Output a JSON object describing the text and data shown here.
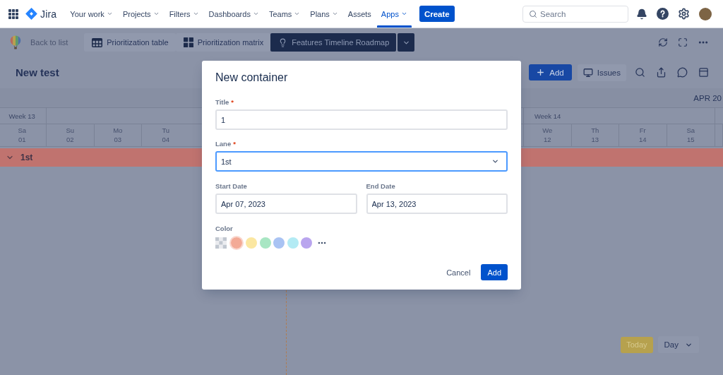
{
  "top_nav": {
    "product": "Jira",
    "items": [
      {
        "label": "Your work",
        "dropdown": true,
        "selected": false
      },
      {
        "label": "Projects",
        "dropdown": true,
        "selected": false
      },
      {
        "label": "Filters",
        "dropdown": true,
        "selected": false
      },
      {
        "label": "Dashboards",
        "dropdown": true,
        "selected": false
      },
      {
        "label": "Teams",
        "dropdown": true,
        "selected": false
      },
      {
        "label": "Plans",
        "dropdown": true,
        "selected": false
      },
      {
        "label": "Assets",
        "dropdown": false,
        "selected": false
      },
      {
        "label": "Apps",
        "dropdown": true,
        "selected": true
      }
    ],
    "create_button": "Create",
    "search": {
      "placeholder": "Search"
    }
  },
  "toolbar": {
    "back_link": "Back to list",
    "tabs": [
      {
        "label": "Prioritization table",
        "selected": false
      },
      {
        "label": "Prioritization matrix",
        "selected": false
      },
      {
        "label": "Features Timeline Roadmap",
        "selected": true
      }
    ]
  },
  "header": {
    "title": "New test",
    "add_button": "Add",
    "issues_button": "Issues"
  },
  "timeline": {
    "month": "APR 20",
    "weeks": [
      {
        "label": "Week 13",
        "days": [
          {
            "day": "Sa",
            "date": "01"
          }
        ]
      },
      {
        "days": [
          {
            "day": "Su",
            "date": "02"
          },
          {
            "day": "Mo",
            "date": "03"
          },
          {
            "day": "Tu",
            "date": "04"
          }
        ]
      },
      {
        "label": "Week 14",
        "days": [
          {
            "day": "We",
            "date": "12"
          },
          {
            "day": "Th",
            "date": "13"
          },
          {
            "day": "Fr",
            "date": "14"
          },
          {
            "day": "Sa",
            "date": "15"
          }
        ]
      }
    ],
    "lanes": [
      {
        "title": "1st",
        "expanded": true
      }
    ],
    "today_button": "Today",
    "scale": "Day"
  },
  "modal": {
    "title": "New container",
    "fields": [
      {
        "kind": "text",
        "label": "Title",
        "required_mark": "*",
        "value": "1",
        "focused": false
      },
      {
        "kind": "select",
        "label": "Lane",
        "required_mark": "*",
        "value": "1st",
        "focused": true
      }
    ],
    "dates": [
      {
        "label": "Start Date",
        "value": "Apr 07, 2023"
      },
      {
        "label": "End Date",
        "value": "Apr 13, 2023"
      }
    ],
    "color_label": "Color",
    "colors": [
      {
        "kind": "none",
        "selected": false
      },
      {
        "kind": "swatch",
        "color": "#f3aa96",
        "selected": true
      },
      {
        "kind": "swatch",
        "color": "#fbe7a1",
        "selected": false
      },
      {
        "kind": "swatch",
        "color": "#a8e6c3",
        "selected": false
      },
      {
        "kind": "swatch",
        "color": "#a9c3f3",
        "selected": false
      },
      {
        "kind": "swatch",
        "color": "#b3ebf4",
        "selected": false
      },
      {
        "kind": "swatch",
        "color": "#b9a5ee",
        "selected": false
      }
    ],
    "cancel_button": "Cancel",
    "submit_button": "Add"
  }
}
